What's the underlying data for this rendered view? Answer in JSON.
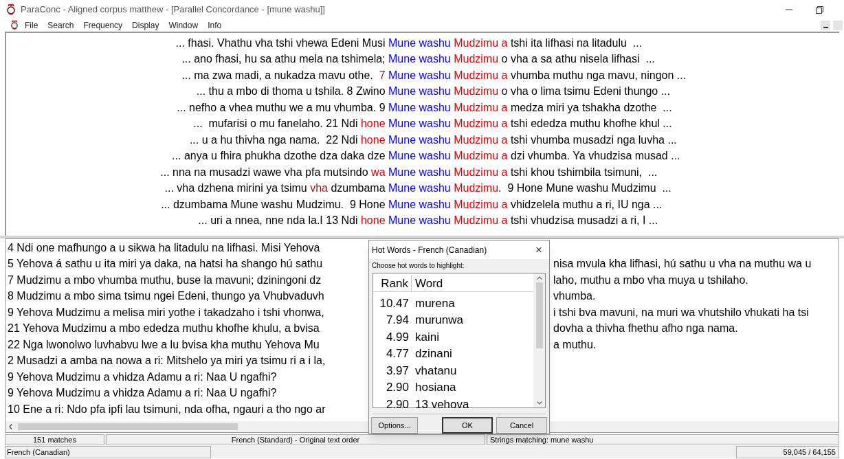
{
  "window": {
    "title": "ParaConc - Aligned corpus matthew - [Parallel Concordance - [mune washu]]"
  },
  "menu": [
    "File",
    "Search",
    "Frequency",
    "Display",
    "Window",
    "Info"
  ],
  "concordance": [
    {
      "left": [
        {
          "text": "... fhasi. Vhathu vha tshi vhewa Edeni Musi ",
          "color": "#000000"
        }
      ],
      "right": [
        {
          "text": "Mune washu ",
          "color": "#0000ff"
        },
        {
          "text": "Mudzimu a ",
          "color": "#e00000"
        },
        {
          "text": "tshi ita lifhasi na litadulu  ...",
          "color": "#000000"
        }
      ]
    },
    {
      "left": [
        {
          "text": "... ano fhasi, hu sa athu mela na tshimela; ",
          "color": "#000000"
        }
      ],
      "right": [
        {
          "text": "Mune washu ",
          "color": "#0000ff"
        },
        {
          "text": "Mudzimu ",
          "color": "#e00000"
        },
        {
          "text": "o vha a sa athu nisela lifhasi  ...",
          "color": "#000000"
        }
      ]
    },
    {
      "left": [
        {
          "text": "... ma zwa madi, a nukadza mavu othe.  ",
          "color": "#000000"
        },
        {
          "text": "7 ",
          "color": "#8b1a1a"
        }
      ],
      "right": [
        {
          "text": "Mune washu ",
          "color": "#0000ff"
        },
        {
          "text": "Mudzimu a ",
          "color": "#e00000"
        },
        {
          "text": "vhumba muthu nga mavu, ningon ...",
          "color": "#000000"
        }
      ]
    },
    {
      "left": [
        {
          "text": "... thu a mbo di thoma u tshila. 8 Zwino ",
          "color": "#000000"
        }
      ],
      "right": [
        {
          "text": "Mune washu ",
          "color": "#0000ff"
        },
        {
          "text": "Mudzimu ",
          "color": "#e00000"
        },
        {
          "text": "o vha o lima tsimu Edeni thungo ...",
          "color": "#000000"
        }
      ]
    },
    {
      "left": [
        {
          "text": "... nefho a vhea muthu we a mu vhumba. 9 ",
          "color": "#000000"
        }
      ],
      "right": [
        {
          "text": "Mune washu ",
          "color": "#0000ff"
        },
        {
          "text": "Mudzimu a ",
          "color": "#e00000"
        },
        {
          "text": "medza miri ya tshakha dzothe  ...",
          "color": "#000000"
        }
      ]
    },
    {
      "left": [
        {
          "text": "...  mufarisi o mu fanelaho. 21 Ndi ",
          "color": "#000000"
        },
        {
          "text": "hone ",
          "color": "#e00000"
        }
      ],
      "right": [
        {
          "text": "Mune washu ",
          "color": "#0000ff"
        },
        {
          "text": "Mudzimu a ",
          "color": "#e00000"
        },
        {
          "text": "tshi ededza muthu khofhe khul ...",
          "color": "#000000"
        }
      ]
    },
    {
      "left": [
        {
          "text": "... u a hu thivha nga nama.  22 Ndi ",
          "color": "#000000"
        },
        {
          "text": "hone ",
          "color": "#e00000"
        }
      ],
      "right": [
        {
          "text": "Mune washu ",
          "color": "#0000ff"
        },
        {
          "text": "Mudzimu a ",
          "color": "#e00000"
        },
        {
          "text": "tshi vhumba musadzi nga luvha ...",
          "color": "#000000"
        }
      ]
    },
    {
      "left": [
        {
          "text": "... anya u fhira phukha dzothe dza daka dze ",
          "color": "#000000"
        }
      ],
      "right": [
        {
          "text": "Mune washu ",
          "color": "#0000ff"
        },
        {
          "text": "Mudzimu a ",
          "color": "#e00000"
        },
        {
          "text": "dzi vhumba. Ya vhudzisa musad ...",
          "color": "#000000"
        }
      ]
    },
    {
      "left": [
        {
          "text": "... nna na musadzi wawe vha pfa mutsindo ",
          "color": "#000000"
        },
        {
          "text": "wa ",
          "color": "#e00000"
        }
      ],
      "right": [
        {
          "text": "Mune washu ",
          "color": "#0000ff"
        },
        {
          "text": "Mudzimu a ",
          "color": "#e00000"
        },
        {
          "text": "tshi khou tshimbila tsimuni,  ...",
          "color": "#000000"
        }
      ]
    },
    {
      "left": [
        {
          "text": "... vha dzhena mirini ya tsimu ",
          "color": "#000000"
        },
        {
          "text": "vha ",
          "color": "#8b1a1a"
        },
        {
          "text": "dzumbama ",
          "color": "#000000"
        }
      ],
      "right": [
        {
          "text": "Mune washu ",
          "color": "#0000ff"
        },
        {
          "text": "Mudzimu",
          "color": "#e00000"
        },
        {
          "text": ".  9 Hone Mune washu Mudzimu  ...",
          "color": "#000000"
        }
      ]
    },
    {
      "left": [
        {
          "text": "... dzumbama Mune washu Mudzimu.  9 Hone ",
          "color": "#000000"
        }
      ],
      "right": [
        {
          "text": "Mune washu ",
          "color": "#0000ff"
        },
        {
          "text": "Mudzimu a ",
          "color": "#e00000"
        },
        {
          "text": "vhidzelela muthu a ri, IU nga ...",
          "color": "#000000"
        }
      ]
    },
    {
      "left": [
        {
          "text": "... uri a nnea, nne nda la.I 13 Ndi ",
          "color": "#000000"
        },
        {
          "text": "hone ",
          "color": "#e00000"
        }
      ],
      "right": [
        {
          "text": "Mune washu ",
          "color": "#0000ff"
        },
        {
          "text": "Mudzimu a ",
          "color": "#e00000"
        },
        {
          "text": "tshi vhudzisa musadzi a ri, I ...",
          "color": "#000000"
        }
      ]
    }
  ],
  "aligned": [
    {
      "left": "4 Ndi one mafhungo a u sikwa ha litadulu na lifhasi. Misi Yehova"
    },
    {
      "left": "5 Yehova á sathu u ita miri ya daka, na hatsi ha shango hú sathu",
      "right": "nisa mvula kha lifhasi, hú sathu u vha na muthu wa u"
    },
    {
      "left": "7 Mudzimu a mbo vhumba muthu, buse la mavuni; dziningoni dz",
      "right": "laho, muthu a mbo vha muya u tshilaho."
    },
    {
      "left": "8 Mudzimu a mbo sima tsimu ngei Edeni, thungo ya Vhubvaduvh",
      "right": "vhumba."
    },
    {
      "left": "9 Yehova Mudzimu a melisa miri yothe i takadzaho i tshi vhonwa,",
      "right": "i tshi bva mavuni, na muri wa vhutshilo vhukati ha tsi"
    },
    {
      "left": "21 Yehova Mudzimu a mbo ededza muthu khofhe khulu, a bvisa",
      "right": "dovha a thivha fhethu afho nga nama."
    },
    {
      "left": "22 Nga lwonolwo luvhabvu lwe a lu bvisa kha muthu Yehova Mu",
      "right": "a muthu."
    },
    {
      "left": "2 Musadzi a amba na nowa a ri: Mitshelo ya miri ya tsimu ri a i la,"
    },
    {
      "left": "9 Yehova Mudzimu a vhidza Adamu a ri: Naa U ngafhi?"
    },
    {
      "left": "9 Yehova Mudzimu a vhidza Adamu a ri: Naa U ngafhi?"
    },
    {
      "left": "10 Ene a ri: Ndo pfa ipfi lau tsimuni, nda ofha, ngauri a tho ngo ar"
    }
  ],
  "status_bar": [
    "151 matches",
    "French (Standard) - Original text order",
    "Strings matching: mune washu"
  ],
  "status_bar_2": [
    "French (Canadian)",
    "59,045 / 64,155"
  ],
  "dialog": {
    "title": "Hot Words - French (Canadian)",
    "close": "×",
    "prompt": "Choose hot words to highlight:",
    "columns": [
      "Rank",
      "Word"
    ],
    "rows": [
      {
        "rank": "10.47",
        "word": "murena"
      },
      {
        "rank": "7.94",
        "word": "murunwa"
      },
      {
        "rank": "4.99",
        "word": "kaini"
      },
      {
        "rank": "4.77",
        "word": "dzinani"
      },
      {
        "rank": "3.97",
        "word": "vhatanu"
      },
      {
        "rank": "2.90",
        "word": "hosiana"
      },
      {
        "rank": "2.90",
        "word": "13 vehova"
      }
    ],
    "buttons": [
      {
        "label": "Options...",
        "default": false
      },
      {
        "label": "OK",
        "default": true
      },
      {
        "label": "Cancel",
        "default": false
      }
    ]
  }
}
